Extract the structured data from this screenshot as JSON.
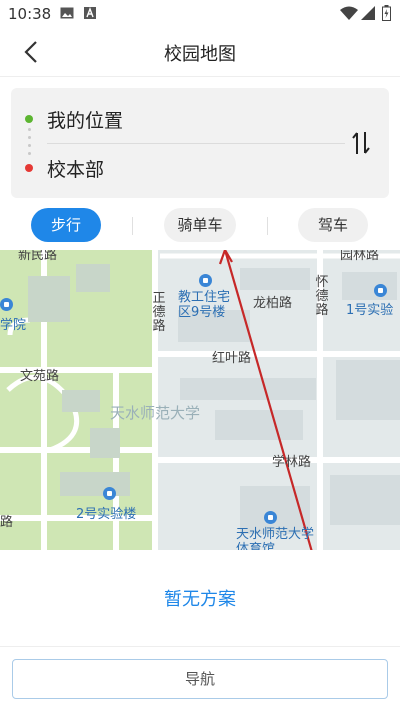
{
  "status_bar": {
    "time": "10:38"
  },
  "header": {
    "title": "校园地图"
  },
  "route": {
    "origin": "我的位置",
    "destination": "校本部",
    "origin_color": "#5cb531",
    "destination_color": "#e53935"
  },
  "tabs": [
    {
      "label": "步行",
      "active": true
    },
    {
      "label": "骑单车",
      "active": false
    },
    {
      "label": "驾车",
      "active": false
    }
  ],
  "map": {
    "labels": {
      "top_left_road": "新民路",
      "top_right_road": "园林路",
      "zhengde_road": "正德路",
      "staff_housing": "教工住宅区9号楼",
      "longbai_road": "龙柏路",
      "huaide_road": "怀德路",
      "lab1": "1号实验",
      "college": "学院",
      "hongye_road": "红叶路",
      "wenyuan_road": "文苑路",
      "university": "天水师范大学",
      "xuelin_road": "学林路",
      "lab2": "2号实验楼",
      "bottom_left_road": "路",
      "gym": "天水师范大学体育馆"
    }
  },
  "result": {
    "no_plan": "暂无方案"
  },
  "nav_button": {
    "label": "导航"
  },
  "colors": {
    "accent": "#1f87e8",
    "route_line": "#c62828"
  }
}
